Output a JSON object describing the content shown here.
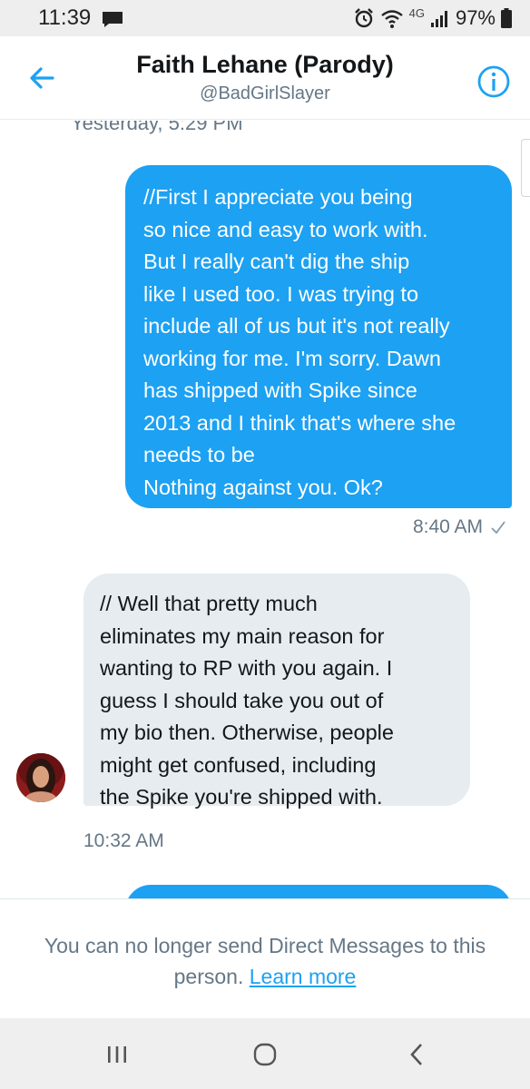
{
  "status_bar": {
    "time": "11:39",
    "network_label": "4G",
    "battery_percent": "97%"
  },
  "header": {
    "title": "Faith Lehane (Parody)",
    "handle": "@BadGirlSlayer"
  },
  "conversation": {
    "date_divider": "Yesterday, 5:29 PM",
    "messages": [
      {
        "direction": "outgoing",
        "text": "//First I appreciate you being\nso nice and easy to work with.\nBut I really can't dig the ship\nlike I used too. I was trying to\ninclude all of us but it's not really\nworking for me. I'm sorry. Dawn\nhas shipped with Spike since\n2013 and I think that's where she\nneeds to be\n Nothing against you. Ok?",
        "time": "8:40 AM"
      },
      {
        "direction": "incoming",
        "text": "// Well that pretty much\neliminates my main reason for\nwanting to RP with you again. I\nguess I should take you out of\nmy bio then. Otherwise, people\nmight get confused, including\nthe Spike you're shipped with.",
        "time": "10:32 AM"
      }
    ]
  },
  "footer": {
    "notice_text": "You can no longer send Direct Messages to this person.",
    "learn_more": "Learn more"
  },
  "colors": {
    "accent": "#1da1f2",
    "incoming_bubble": "#e6ecf0",
    "secondary_text": "#657786"
  },
  "icons": {
    "back": "arrow-left-icon",
    "info": "info-circle-icon",
    "read": "checkmark-icon",
    "nav_recent": "recent-apps-icon",
    "nav_home": "home-icon",
    "nav_back": "chevron-left-icon"
  }
}
